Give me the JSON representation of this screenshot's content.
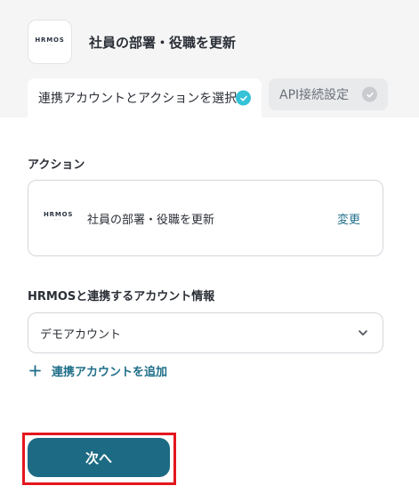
{
  "header": {
    "app_logo": "HRMOS",
    "page_title": "社員の部署・役職を更新"
  },
  "tabs": [
    {
      "label": "連携アカウントとアクションを選択",
      "active": true
    },
    {
      "label": "API接続設定",
      "active": false
    }
  ],
  "action_section": {
    "label": "アクション",
    "card": {
      "logo": "HRMOS",
      "action_name": "社員の部署・役職を更新",
      "change_label": "変更"
    }
  },
  "account_section": {
    "label": "HRMOSと連携するアカウント情報",
    "selected_account": "デモアカウント",
    "add_account_label": "連携アカウントを追加"
  },
  "footer": {
    "next_label": "次へ"
  },
  "colors": {
    "accent": "#1c6a83",
    "link": "#1f6f89",
    "check_active": "#35c2d8",
    "highlight": "#e4161d"
  }
}
